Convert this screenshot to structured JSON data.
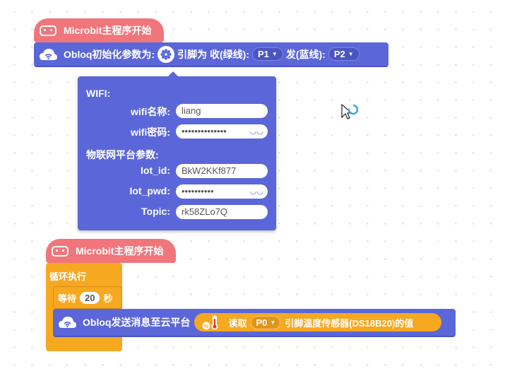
{
  "hat1": {
    "label": "Microbit主程序开始"
  },
  "obloq_init": {
    "label": "Obloq初始化参数为:",
    "pin_label": "引脚为 收(绿线):",
    "rx_pin": "P1",
    "tx_label": "发(蓝线):",
    "tx_pin": "P2"
  },
  "config_popup": {
    "wifi_header": "WIFI:",
    "wifi_name_label": "wifi名称:",
    "wifi_name_value": "liang",
    "wifi_pwd_label": "wifi密码:",
    "wifi_pwd_value": "••••••••••••••",
    "iot_header": "物联网平台参数:",
    "iot_id_label": "Iot_id:",
    "iot_id_value": "BkW2KKf877",
    "iot_pwd_label": "Iot_pwd:",
    "iot_pwd_value": "••••••••••",
    "topic_label": "Topic:",
    "topic_value": "rk58ZLo7Q"
  },
  "hat2": {
    "label": "Microbit主程序开始"
  },
  "loop": {
    "label": "循环执行"
  },
  "wait": {
    "label_before": "等待",
    "seconds": "20",
    "label_after": "秒"
  },
  "send_block": {
    "label": "Obloq发送消息至云平台"
  },
  "temp_reporter": {
    "read_label": "读取",
    "pin": "P0",
    "sensor_label": "引脚温度传感器(DS18B20)的值"
  },
  "colors": {
    "hat": "#f0767c",
    "obloq_blue": "#5b67d8",
    "control_orange": "#f6a821"
  },
  "icons": [
    "microbit-icon",
    "cloud-wifi-icon",
    "gear-icon",
    "caret-down-icon",
    "eye-icon",
    "thermometer-icon",
    "cursor-icon"
  ]
}
